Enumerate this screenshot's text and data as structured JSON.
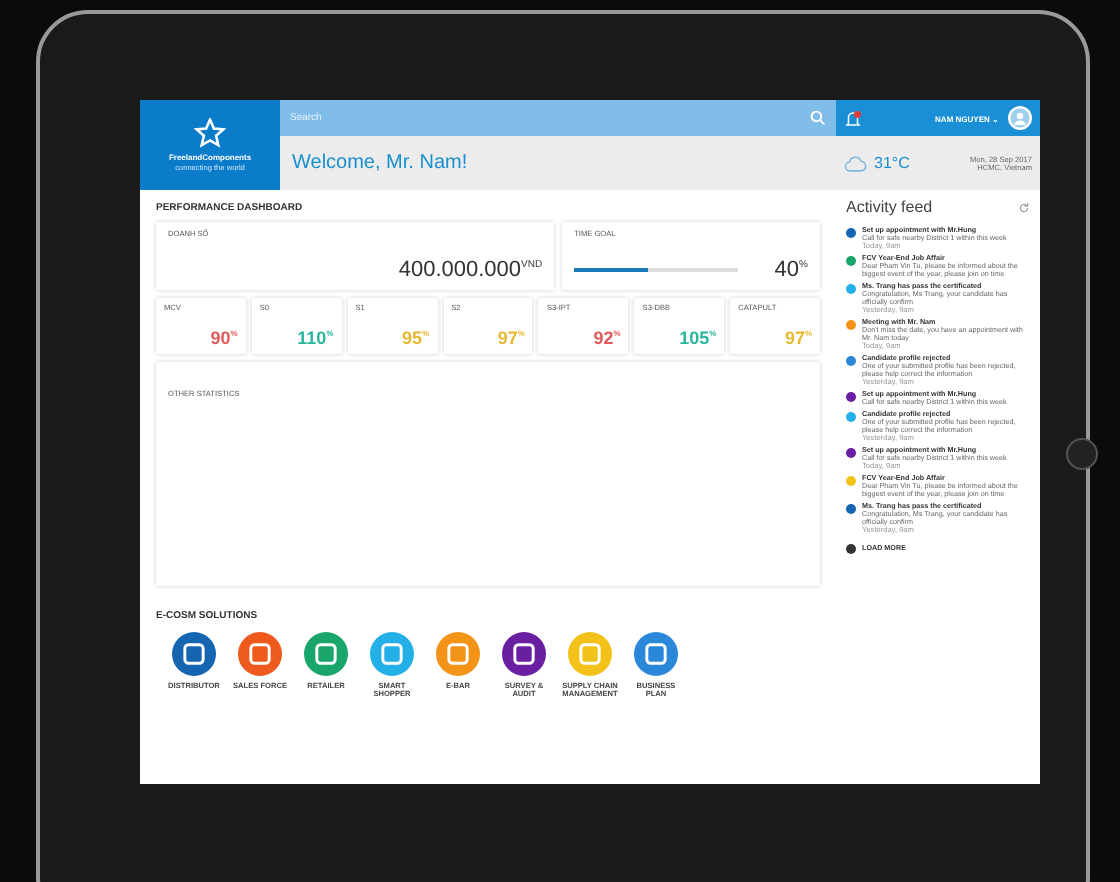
{
  "brand": {
    "name": "FreelandComponents",
    "tagline": "connecting the world"
  },
  "search": {
    "placeholder": "Search"
  },
  "welcome": "Welcome, Mr. Nam!",
  "user": {
    "name": "NAM NGUYEN ⌄"
  },
  "weather": {
    "temp": "31°C",
    "date": "Mon, 28 Sep 2017",
    "place": "HCMC, Vietnam"
  },
  "dashboard": {
    "title": "PERFORMANCE DASHBOARD",
    "revenue": {
      "label": "DOANH SỐ",
      "value": "400.000.000$^{VND}$"
    },
    "time_goal": {
      "label": "TIME GOAL",
      "level": 0.45,
      "value": "40$^{%}$"
    },
    "metrics": [
      {
        "label": "MCV",
        "value": "90$^{%}$",
        "color": "#e05a5a"
      },
      {
        "label": "S0",
        "value": "110$^{%}$",
        "color": "#2bb59a"
      },
      {
        "label": "S1",
        "value": "95$^{%}$",
        "color": "#e8b830"
      },
      {
        "label": "S2",
        "value": "97$^{%}$",
        "color": "#e8b830"
      },
      {
        "label": "S3-IPT",
        "value": "92$^{%}$",
        "color": "#e05a5a"
      },
      {
        "label": "S3-DBB",
        "value": "105$^{%}$",
        "color": "#2bb59a"
      },
      {
        "label": "CATAPULT",
        "value": "97$^{%}$",
        "color": "#e8b830"
      }
    ],
    "other_title": "OTHER STATISTICS"
  },
  "solutions": {
    "title": "E-COSM SOLUTIONS",
    "items": [
      {
        "label": "DISTRIBUTOR",
        "color": "#1565b0"
      },
      {
        "label": "SALES FORCE",
        "color": "#ee5a1e"
      },
      {
        "label": "RETAILER",
        "color": "#1aa56a"
      },
      {
        "label": "SMART SHOPPER",
        "color": "#23b0e6"
      },
      {
        "label": "E-BAR",
        "color": "#f39419"
      },
      {
        "label": "SURVEY & AUDIT",
        "color": "#6a1fa2"
      },
      {
        "label": "SUPPLY CHAIN MANAGEMENT",
        "color": "#f2c21b"
      },
      {
        "label": "BUSINESS PLAN",
        "color": "#2b88d8"
      }
    ]
  },
  "feed": {
    "title": "Activity feed",
    "load_more": "LOAD MORE",
    "items": [
      {
        "title": "Set up appointment with Mr.Hung",
        "body": "Call for safe nearby District 1 within this week",
        "time": "Today, 9am",
        "color": "#1565b0"
      },
      {
        "title": "FCV Year-End Job Affair",
        "body": "Dear Pham Vin Tu, please be informed about the biggest event of the year, please join on time",
        "color": "#1aa56a"
      },
      {
        "title": "Ms. Trang has pass the certificated",
        "body": "Congratulation, Ms Trang, your candidate has officially confirm",
        "time": "Yesterday, 9am",
        "color": "#23b0e6"
      },
      {
        "title": "Meeting with Mr. Nam",
        "body": "Don't miss the date, you have an appointment with Mr. Nam today",
        "time": "Today, 9am",
        "color": "#f39419"
      },
      {
        "title": "Candidate profile rejected",
        "body": "One of your submitted profile has been rejected, please help correct the information",
        "time": "Yesterday, 9am",
        "color": "#2b88d8"
      },
      {
        "title": "Set up appointment with Mr.Hung",
        "body": "Call for safe nearby District 1 within this week",
        "color": "#6a1fa2"
      },
      {
        "title": "Candidate profile rejected",
        "body": "One of your submitted profile has been rejected, please help correct the information",
        "time": "Yesterday, 9am",
        "color": "#23b0e6"
      },
      {
        "title": "Set up appointment with Mr.Hung",
        "body": "Call for safe nearby District 1 within this week",
        "time": "Today, 9am",
        "color": "#6a1fa2"
      },
      {
        "title": "FCV Year-End Job Affair",
        "body": "Dear Pham Vin Tu, please be informed about the biggest event of the year, please join on time",
        "color": "#f2c21b"
      },
      {
        "title": "Ms. Trang has pass the certificated",
        "body": "Congratulation, Ms Trang, your candidate has officially confirm",
        "time": "Yesterday, 9am",
        "color": "#1565b0"
      }
    ]
  }
}
